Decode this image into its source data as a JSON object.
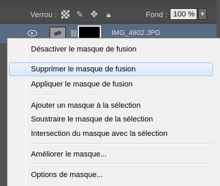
{
  "layers_panel": {
    "lock_label": "Verrou :",
    "fill_label": "Fond :",
    "fill_value": "100 %",
    "layer_name": "IMG_4802.JPG",
    "selection_color": "#596a83",
    "panel_color": "#535353"
  },
  "context_menu": {
    "items": [
      {
        "label": "Désactiver le masque de fusion"
      },
      {
        "label": "Supprimer le masque de fusion",
        "highlighted": true
      },
      {
        "label": "Appliquer le masque de fusion"
      },
      {
        "label": "Ajouter un masque à la sélection"
      },
      {
        "label": "Soustraire le masque de la sélection"
      },
      {
        "label": "Intersection du masque avec la sélection"
      },
      {
        "label": "Améliorer le masque..."
      },
      {
        "label": "Options de masque..."
      }
    ],
    "highlight_color": "#d9e8f8"
  }
}
